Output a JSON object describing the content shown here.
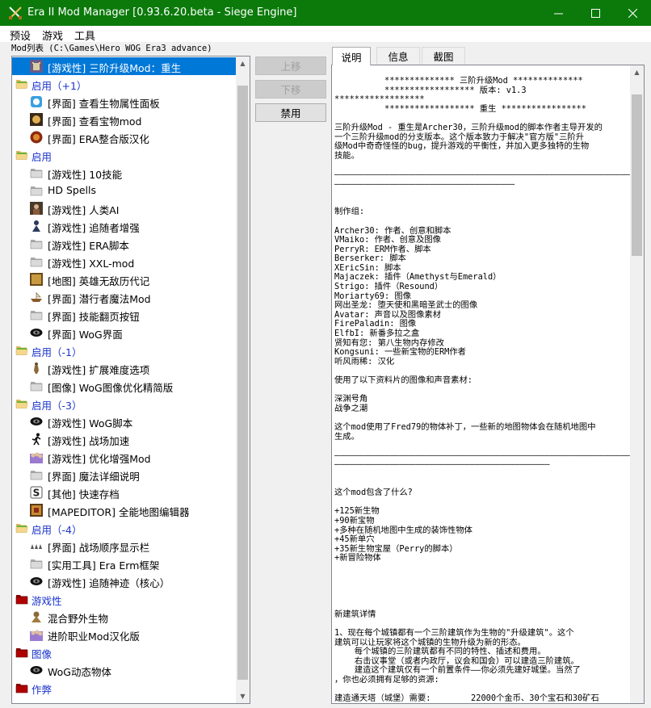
{
  "window": {
    "title": "Era II Mod Manager [0.93.6.20.beta - Siege Engine]",
    "minimize_glyph": "—",
    "maximize_glyph": "☐",
    "close_glyph": "✕"
  },
  "menu": [
    "预设",
    "游戏",
    "工具"
  ],
  "modlist": {
    "label": "Mod列表 (C:\\Games\\Hero WOG Era3 advance)",
    "rows": [
      {
        "text": "[游戏性] 三阶升级Mod：重生",
        "type": "mod",
        "icon": "castle-icon",
        "selected": true
      },
      {
        "text": "启用（+1）",
        "type": "group",
        "icon": "folder-open-icon"
      },
      {
        "text": "[界面] 查看生物属性面板",
        "type": "mod",
        "icon": "creature-panel-icon"
      },
      {
        "text": "[界面] 查看宝物mod",
        "type": "mod",
        "icon": "artifact-icon"
      },
      {
        "text": "[界面] ERA整合版汉化",
        "type": "mod",
        "icon": "era-logo-icon"
      },
      {
        "text": "启用",
        "type": "group",
        "icon": "folder-open-icon"
      },
      {
        "text": "[游戏性] 10技能",
        "type": "mod",
        "icon": "folder-icon"
      },
      {
        "text": "HD Spells",
        "type": "mod",
        "icon": "folder-icon"
      },
      {
        "text": "[游戏性] 人类AI",
        "type": "mod",
        "icon": "ai-portrait-icon"
      },
      {
        "text": "[游戏性] 追随者增强",
        "type": "mod",
        "icon": "follower-icon"
      },
      {
        "text": "[游戏性] ERA脚本",
        "type": "mod",
        "icon": "folder-icon"
      },
      {
        "text": "[游戏性] XXL-mod",
        "type": "mod",
        "icon": "folder-icon"
      },
      {
        "text": "[地图] 英雄无敌历代记",
        "type": "mod",
        "icon": "chronicles-icon"
      },
      {
        "text": "[界面] 潜行者魔法Mod",
        "type": "mod",
        "icon": "ship-icon"
      },
      {
        "text": "[界面] 技能翻页按钮",
        "type": "mod",
        "icon": "folder-icon"
      },
      {
        "text": "[界面] WoG界面",
        "type": "mod",
        "icon": "wog-icon"
      },
      {
        "text": "启用（-1）",
        "type": "group",
        "icon": "folder-open-icon"
      },
      {
        "text": "[游戏性] 扩展难度选项",
        "type": "mod",
        "icon": "hero-figure-icon"
      },
      {
        "text": "[图像] WoG图像优化精简版",
        "type": "mod",
        "icon": "folder-icon"
      },
      {
        "text": "启用（-3）",
        "type": "group",
        "icon": "folder-open-icon"
      },
      {
        "text": "[游戏性] WoG脚本",
        "type": "mod",
        "icon": "wog-icon"
      },
      {
        "text": "[游戏性] 战场加速",
        "type": "mod",
        "icon": "running-man-icon"
      },
      {
        "text": "[游戏性] 优化增强Mod",
        "type": "mod",
        "icon": "crowd-icon"
      },
      {
        "text": "[界面] 魔法详细说明",
        "type": "mod",
        "icon": "folder-icon"
      },
      {
        "text": "[其他] 快速存档",
        "type": "mod",
        "icon": "save-icon"
      },
      {
        "text": "[MAPEDITOR] 全能地图编辑器",
        "type": "mod",
        "icon": "map-editor-icon"
      },
      {
        "text": "启用（-4）",
        "type": "group",
        "icon": "folder-open-icon"
      },
      {
        "text": "[界面] 战场顺序显示栏",
        "type": "mod",
        "icon": "queue-bar-icon"
      },
      {
        "text": "[实用工具] Era Erm框架",
        "type": "mod",
        "icon": "folder-icon"
      },
      {
        "text": "[游戏性] 追随神迹（核心）",
        "type": "mod",
        "icon": "wog-icon"
      },
      {
        "text": "游戏性",
        "type": "category",
        "icon": "folder-red-icon"
      },
      {
        "text": "混合野外生物",
        "type": "mod",
        "icon": "monster-icon"
      },
      {
        "text": "进阶职业Mod汉化版",
        "type": "mod",
        "icon": "crowd-icon"
      },
      {
        "text": "图像",
        "type": "category",
        "icon": "folder-red-icon"
      },
      {
        "text": "WoG动态物体",
        "type": "mod",
        "icon": "wog-icon"
      },
      {
        "text": "作弊",
        "type": "category",
        "icon": "folder-red-icon"
      }
    ]
  },
  "buttons": {
    "move_up": "上移",
    "move_down": "下移",
    "disable": "禁用"
  },
  "tabs": [
    "说明",
    "信息",
    "截图"
  ],
  "description": {
    "lines": [
      "          ************** 三阶升级Mod **************",
      "          ****************** 版本: v1.3",
      "******************",
      "          ****************** 重生 *****************",
      "",
      "三阶升级Mod - 重生是Archer30，三阶升级mod的脚本作者主导开发的",
      "一个三阶升级mod的分支版本。这个版本致力于解决\"官方版\"三阶升",
      "级Mod中奇奇怪怪的bug，提升游戏的平衡性，并加入更多独特的生物",
      "技能。",
      "",
      "————————————————————————————————————————————————————————————",
      "————————————————————————————————————",
      "",
      "",
      "制作组:",
      "",
      "Archer30: 作者、创意和脚本",
      "VMaiko: 作者、创意及图像",
      "PerryR: ERM作者、脚本",
      "Berserker: 脚本",
      "XEricSin: 脚本",
      "Majaczek: 插件（Amethyst与Emerald）",
      "Strigo: 插件（Resound）",
      "Moriarty69: 图像",
      "网出圣龙: 堕天使和黑暗圣武士的图像",
      "Avatar: 声音以及图像素材",
      "FirePaladin: 图像",
      "ElfbI: 新番多拉之盒",
      "贤知有您: 第八生物内存修改",
      "Kongsuni: 一些新宝物的ERM作者",
      "听风雨稀: 汉化",
      "",
      "使用了以下资料片的图像和声音素材:",
      "",
      "深渊号角",
      "战争之潮",
      "",
      "这个mod使用了Fred79的物体补丁，一些新的地图物体会在随机地图中",
      "生成。",
      "",
      "————————————————————————————————————————————————————————————",
      "———————————————————————————————————————————",
      "",
      "",
      "这个mod包含了什么?",
      "",
      "+125新生物",
      "+90新宝物",
      "+多种在随机地图中生成的装饰性物体",
      "+45新单穴",
      "+35新生物宝屋（Perry的脚本）",
      "+新冒险物体",
      "",
      "",
      "",
      "",
      "",
      "新建筑详情",
      "",
      "1、现在每个城镇都有一个三阶建筑作为生物的\"升级建筑\"。这个",
      "建筑可以让玩家将这个城镇的生物升级为新的形态。",
      "    每个城镇的三阶建筑都有不同的特性、插述和费用。",
      "    右击议事堂（或者内政厅，议会和国会）可以建造三阶建筑。",
      "    建造这个建筑仅有一个前置条件——你必须先建好城堡。当然了",
      "，你也必须拥有足够的资源:",
      "",
      "建造通天塔（城堡）需要:        22000个金币、30个宝石和30矿石"
    ]
  }
}
